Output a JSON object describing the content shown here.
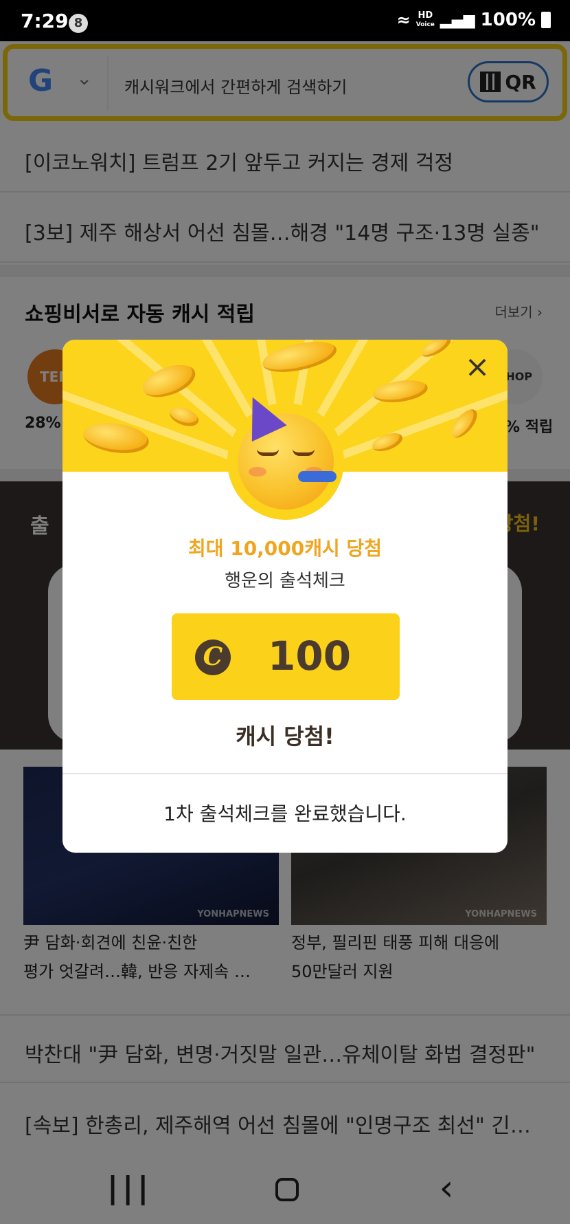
{
  "status_bar": {
    "time": "7:29",
    "notification_count": "8",
    "network": "HD Voice",
    "battery": "100%"
  },
  "search": {
    "placeholder": "캐시워크에서 간편하게 검색하기",
    "qr_label": "QR",
    "engine": "G"
  },
  "news_top": [
    "[이코노워치] 트럼프 2기 앞두고 커지는 경제 걱정",
    "[3보] 제주 해상서 어선 침몰…해경 \"14명 구조·13명 실종\""
  ],
  "shopping": {
    "title": "쇼핑비서로 자동 캐시 적립",
    "more": "더보기",
    "left_pct": "28%",
    "right_pct": "% 적립",
    "left_logo": "TEN",
    "right_logo": "SHOP"
  },
  "attendance_band": {
    "left_title": "출",
    "right_title": "당첨!"
  },
  "news_photos": [
    {
      "caption_line1": "尹 담화·회견에 친윤·친한",
      "caption_line2": "평가 엇갈려…韓, 반응 자제속 …",
      "watermark": "YONHAPNEWS"
    },
    {
      "caption_line1": "정부, 필리핀 태풍 피해 대응에",
      "caption_line2": "50만달러 지원",
      "watermark": "YONHAPNEWS"
    }
  ],
  "news_bottom": [
    "박찬대 \"尹 담화, 변명·거짓말 일관…유체이탈 화법 결정판\"",
    "[속보] 한총리, 제주해역 어선 침몰에 \"인명구조 최선\" 긴…"
  ],
  "popup": {
    "close_label": "×",
    "headline": "최대 10,000캐시 당첨",
    "subtitle": "행운의 출석체크",
    "coin_symbol": "C",
    "amount": "100",
    "result": "캐시 당첨!",
    "completion": "1차 출석체크를 완료했습니다."
  },
  "nav": {
    "recent": "|||",
    "back": "‹"
  },
  "colors": {
    "accent_yellow": "#fcd41c",
    "headline_orange": "#f0a520",
    "coin_brown": "#4a3b2e",
    "search_border": "#f7cf10"
  }
}
